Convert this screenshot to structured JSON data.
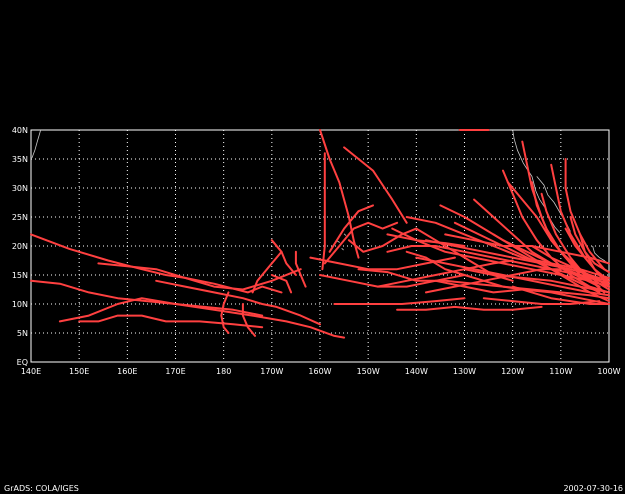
{
  "map": {
    "lat_labels": [
      "40N",
      "35N",
      "30N",
      "25N",
      "20N",
      "15N",
      "10N",
      "5N",
      "EQ"
    ],
    "lon_labels": [
      "140E",
      "150E",
      "160E",
      "170E",
      "180",
      "170W",
      "160W",
      "150W",
      "140W",
      "130W",
      "120W",
      "110W",
      "100W"
    ],
    "track_color": "#ff4040",
    "coast_color": "#c8c8c8",
    "grid_color": "#ffffff",
    "frame_color": "#ffffff",
    "lat_range": [
      0,
      40
    ],
    "lon_range": [
      140,
      260
    ],
    "grid": true
  },
  "footer": {
    "left": "GrADS: COLA/IGES",
    "right": "2002-07-30-16"
  }
}
